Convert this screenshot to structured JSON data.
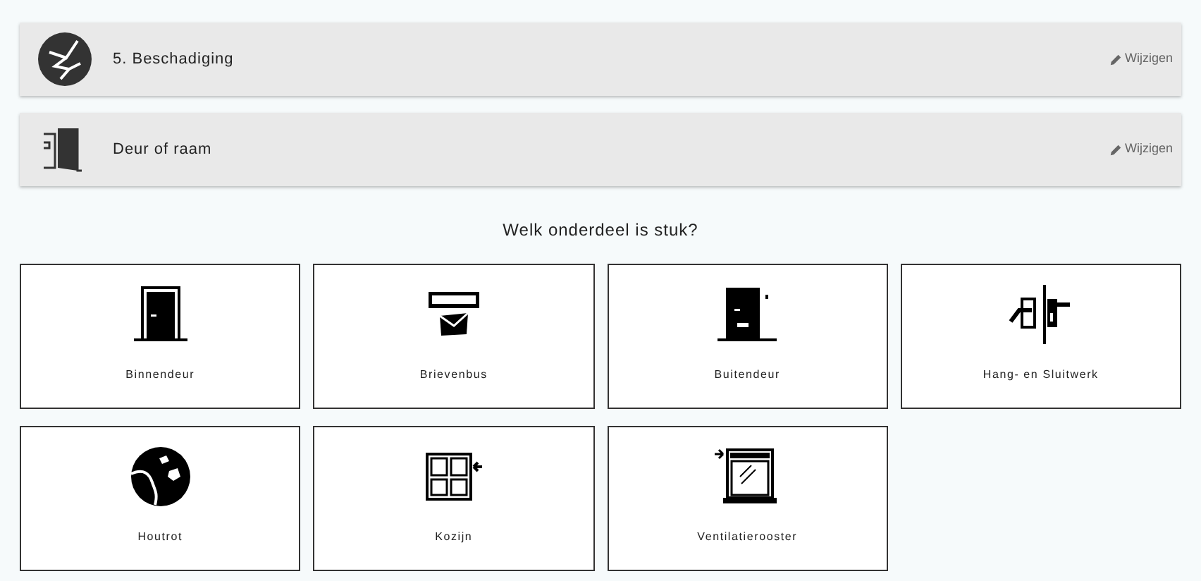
{
  "summary": [
    {
      "label": "5. Beschadiging",
      "action": "Wijzigen"
    },
    {
      "label": "Deur of raam",
      "action": "Wijzigen"
    }
  ],
  "question": "Welk onderdeel is stuk?",
  "options": [
    {
      "label": "Binnendeur"
    },
    {
      "label": "Brievenbus"
    },
    {
      "label": "Buitendeur"
    },
    {
      "label": "Hang- en Sluitwerk"
    },
    {
      "label": "Houtrot"
    },
    {
      "label": "Kozijn"
    },
    {
      "label": "Ventilatierooster"
    }
  ]
}
